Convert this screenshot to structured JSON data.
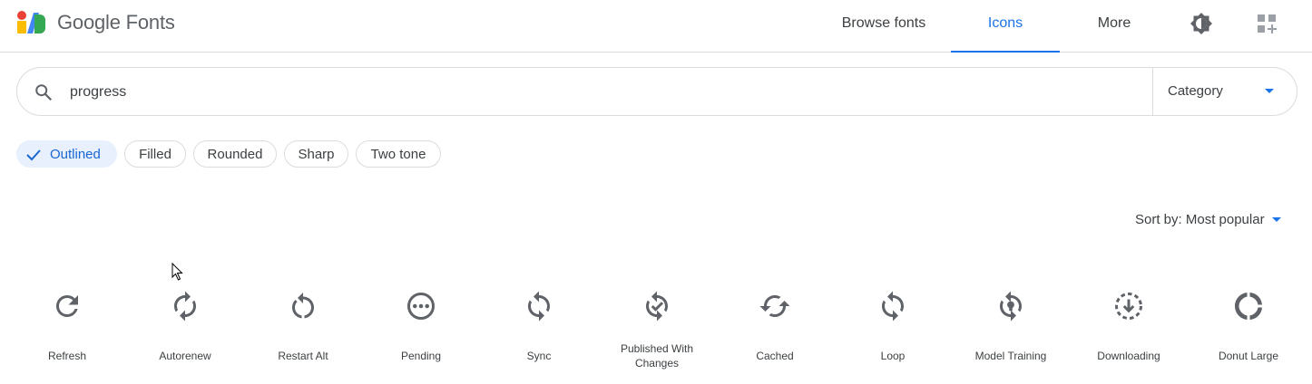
{
  "header": {
    "brand": "Google Fonts",
    "nav": {
      "browse_fonts": "Browse fonts",
      "icons": "Icons",
      "more": "More"
    },
    "active_nav": "Icons",
    "accent_color": "#1a73e8"
  },
  "search": {
    "value": "progress",
    "category_label": "Category"
  },
  "styles": {
    "outlined": "Outlined",
    "filled": "Filled",
    "rounded": "Rounded",
    "sharp": "Sharp",
    "two_tone": "Two tone",
    "selected": "Outlined"
  },
  "sort": {
    "label": "Sort by: Most popular"
  },
  "icons": [
    {
      "label": "Refresh",
      "icon": "refresh-icon"
    },
    {
      "label": "Autorenew",
      "icon": "autorenew-icon"
    },
    {
      "label": "Restart Alt",
      "icon": "restart-alt-icon"
    },
    {
      "label": "Pending",
      "icon": "pending-icon"
    },
    {
      "label": "Sync",
      "icon": "sync-icon"
    },
    {
      "label": "Published With Changes",
      "icon": "published-with-changes-icon"
    },
    {
      "label": "Cached",
      "icon": "cached-icon"
    },
    {
      "label": "Loop",
      "icon": "loop-icon"
    },
    {
      "label": "Model Training",
      "icon": "model-training-icon"
    },
    {
      "label": "Downloading",
      "icon": "downloading-icon"
    },
    {
      "label": "Donut Large",
      "icon": "donut-large-icon"
    }
  ]
}
